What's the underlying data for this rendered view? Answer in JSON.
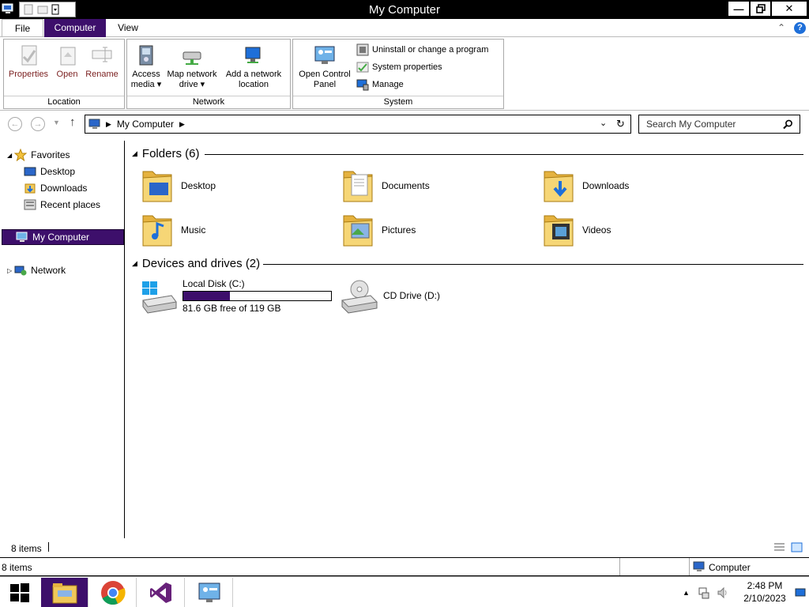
{
  "window": {
    "title": "My Computer"
  },
  "tabs": {
    "file": "File",
    "computer": "Computer",
    "view": "View"
  },
  "ribbon": {
    "location": {
      "label": "Location",
      "properties": "Properties",
      "open": "Open",
      "rename": "Rename"
    },
    "network": {
      "label": "Network",
      "access_media_1": "Access",
      "access_media_2": "media ▾",
      "map_drive_1": "Map network",
      "map_drive_2": "drive ▾",
      "add_location_1": "Add a network",
      "add_location_2": "location"
    },
    "system": {
      "label": "System",
      "control_panel_1": "Open Control",
      "control_panel_2": "Panel",
      "uninstall": "Uninstall or change a program",
      "sys_props": "System properties",
      "manage": "Manage"
    }
  },
  "address": {
    "path": "My Computer",
    "search_placeholder": "Search My Computer"
  },
  "nav": {
    "favorites": "Favorites",
    "desktop": "Desktop",
    "downloads": "Downloads",
    "recent": "Recent places",
    "computer": "My Computer",
    "network": "Network"
  },
  "folders": {
    "title": "Folders (6)",
    "items": [
      "Desktop",
      "Documents",
      "Downloads",
      "Music",
      "Pictures",
      "Videos"
    ]
  },
  "drives": {
    "title": "Devices and drives (2)",
    "local": {
      "name": "Local Disk (C:)",
      "free": "81.6 GB free of 119 GB",
      "used_fraction": 0.314
    },
    "cd": {
      "name": "CD Drive (D:)"
    }
  },
  "status": {
    "items": "8 items",
    "items2": "8 items",
    "location": "Computer"
  },
  "taskbar": {
    "time": "2:48 PM",
    "date": "2/10/2023"
  },
  "colors": {
    "accent": "#3d0f6b",
    "folder": "#f0c85a"
  }
}
